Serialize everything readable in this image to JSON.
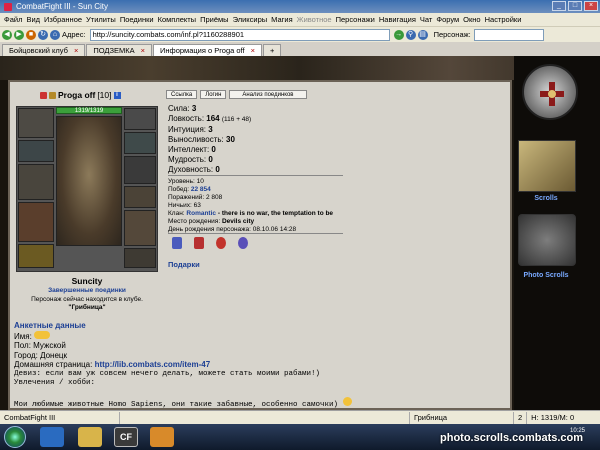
{
  "window": {
    "title": "CombatFight III - Sun City"
  },
  "menu": [
    "Файл",
    "Вид",
    "Избранное",
    "Утилиты",
    "Поединки",
    "Комплекты",
    "Приёмы",
    "Эликсиры",
    "Магия",
    "Животное",
    "Персонажи",
    "Навигация",
    "Чат",
    "Форум",
    "Окно",
    "Настройки"
  ],
  "menu_dim": "Животное",
  "address": {
    "label": "Адрес:",
    "url": "http://suncity.combats.com/inf.pl?1160288901",
    "pers_label": "Персонаж:"
  },
  "tabs": [
    {
      "label": "Бойцовский клуб"
    },
    {
      "label": "ПОДЗЕМКА"
    },
    {
      "label": "Информация о Proga off",
      "active": true
    }
  ],
  "character": {
    "name": "Proga off",
    "level": "[10]",
    "hp": "1319/1319",
    "display_name": "Suncity",
    "duels_link": "Завершенные поединки",
    "location": "Персонаж сейчас находится в клубе.",
    "room": "\"Грибница\""
  },
  "buttons": [
    "Ссылка",
    "Логин",
    "Анализ поединков"
  ],
  "stats": [
    {
      "label": "Сила:",
      "value": "3",
      "extra": ""
    },
    {
      "label": "Ловкость:",
      "value": "164",
      "extra": "(116 + 48)"
    },
    {
      "label": "Интуиция:",
      "value": "3",
      "extra": ""
    },
    {
      "label": "Выносливость:",
      "value": "30",
      "extra": ""
    },
    {
      "label": "Интеллект:",
      "value": "0",
      "extra": ""
    },
    {
      "label": "Мудрость:",
      "value": "0",
      "extra": ""
    },
    {
      "label": "Духовность:",
      "value": "0",
      "extra": ""
    }
  ],
  "info": {
    "level": "Уровень: 10",
    "wins_label": "Побед:",
    "wins": "22 854",
    "losses": "Поражений: 2 808",
    "draws": "Ничьих: 63",
    "clan_label": "Клан:",
    "clan": "Romantic",
    "clan_motto": "- there is no war, the temptation to be",
    "birthplace_label": "Место рождения:",
    "birthplace": "Devils city",
    "birthday": "День рождения персонажа: 08.10.06 14:28"
  },
  "gifts": "Подарки",
  "profile": {
    "title": "Анкетные данные",
    "name": "Имя:",
    "gender": "Пол: Мужской",
    "city": "Город: Донецк",
    "homepage_label": "Домашняя страница:",
    "homepage": "http://lib.combats.com/item-47",
    "motto": "Девиз: если вам уж совсем нечего делать, можете стать моими рабами!)",
    "hobbies": "Увлечения / хобби:",
    "about": "Мои любимые животные Homo Sapiens, они такие забавные, особенно самочки)"
  },
  "side": {
    "scrolls": "Scrolls",
    "photo": "Photo Scrolls"
  },
  "status": {
    "app": "CombatFight III",
    "room": "Грибница",
    "slot": "2",
    "hp": "H: 1319/M: 0"
  },
  "taskbar": {
    "app_label": "CF",
    "clock": "10:25"
  },
  "watermark": "photo.scrolls.combats.com",
  "colors": {
    "link": "#1c3f94",
    "hp": "#3ba03b",
    "frame_bg": "#d7d4cc"
  }
}
